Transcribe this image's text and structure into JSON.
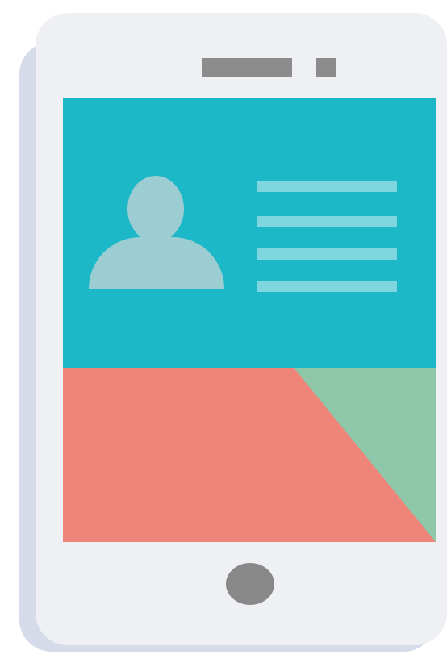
{
  "illustration": {
    "subject": "smartphone-profile-card",
    "colors": {
      "phone_body": "#eef0f4",
      "phone_shadow": "#d6dbe9",
      "screen_top": "#1cb8c8",
      "avatar": "#9ccdd3",
      "text_lines": "#7ed6de",
      "screen_bottom_coral": "#ef8478",
      "screen_bottom_green": "#8ec7aa",
      "speaker_camera_button": "#8c8c8c"
    },
    "icons": {
      "avatar": "user-avatar-icon",
      "text_lines": "text-lines-icon",
      "home_button": "home-button-icon"
    }
  }
}
